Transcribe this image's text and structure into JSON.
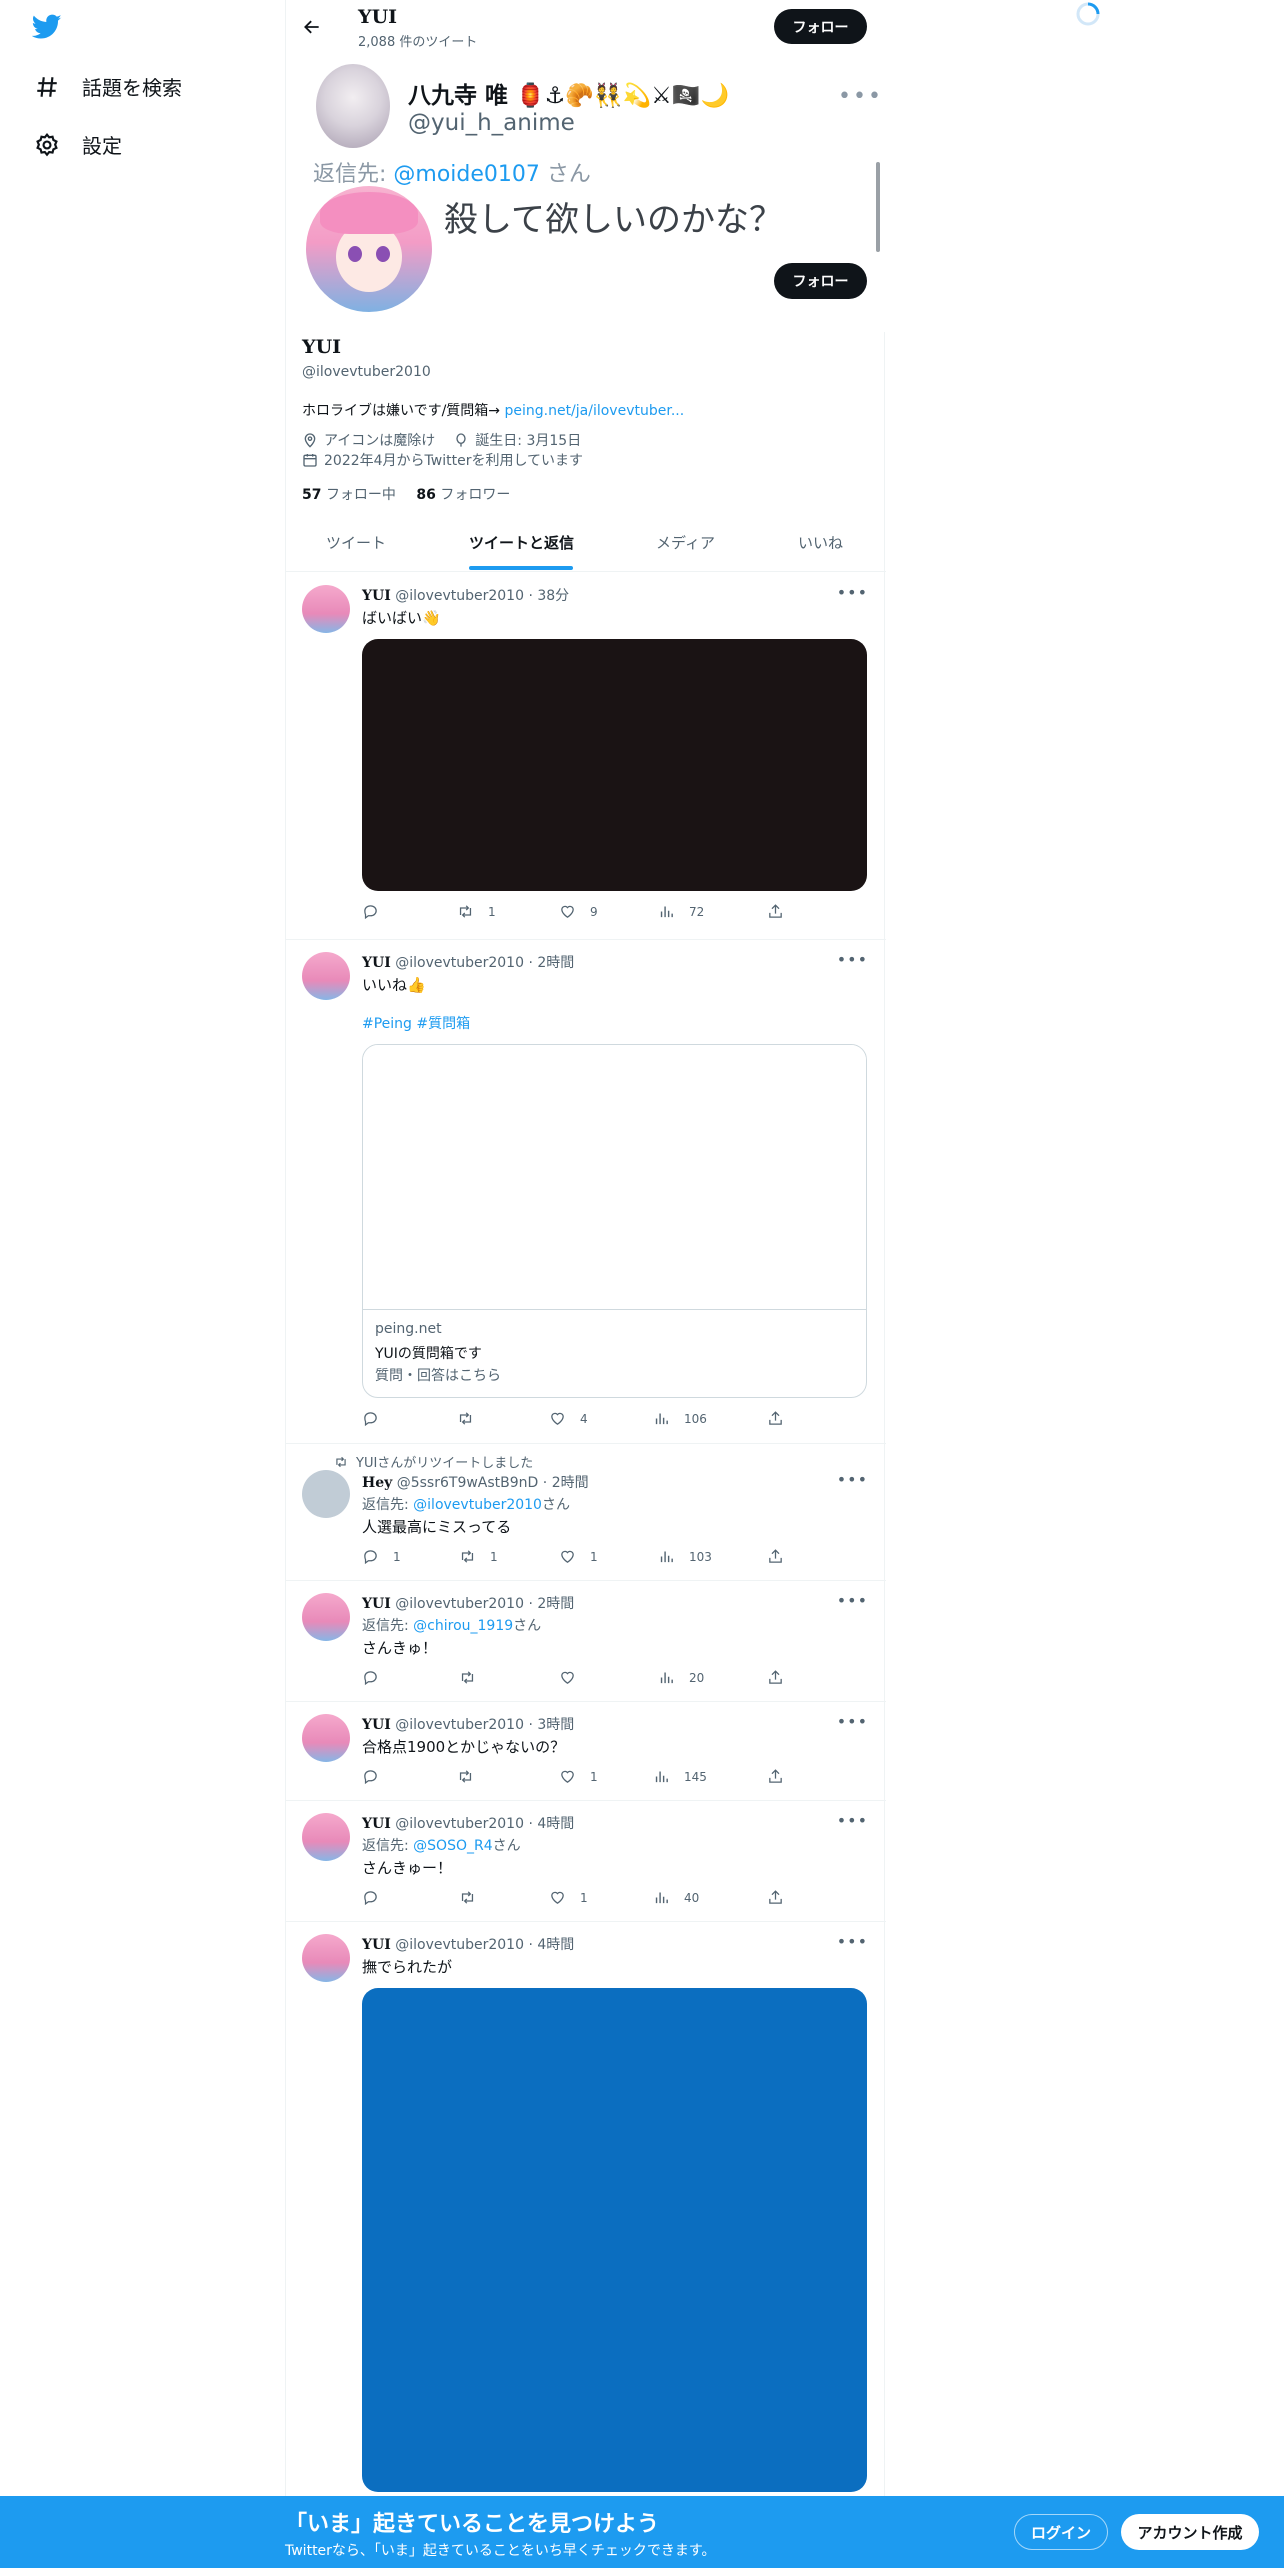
{
  "sidebar": {
    "items": [
      {
        "label": "話題を検索",
        "icon": "hashtag-icon"
      },
      {
        "label": "設定",
        "icon": "gear-icon"
      }
    ]
  },
  "header": {
    "name": "YUI",
    "tweet_count": "2,088 件のツイート",
    "follow_label": "フォロー"
  },
  "pinned_overlay": {
    "name": "八九寺 唯 🏮⚓🥐👯💫⚔🏴‍☠️🌙",
    "handle": "@yui_h_anime",
    "reply_to_prefix": "返信先: ",
    "reply_to_user": "@moide0107",
    "reply_to_suffix": " さん",
    "text": "殺して欲しいのかな？"
  },
  "profile": {
    "name": "YUI",
    "handle": "@ilovevtuber2010",
    "bio": "ホロライブは嫌いです/質問箱→ ",
    "bio_link": "peing.net/ja/ilovevtuber...",
    "location": "アイコンは魔除け",
    "birthday": "誕生日: 3月15日",
    "joined": "2022年4月からTwitterを利用しています",
    "following_count": "57",
    "following_label": "フォロー中",
    "followers_count": "86",
    "followers_label": "フォロワー",
    "follow_label": "フォロー"
  },
  "tabs": [
    {
      "label": "ツイート",
      "active": false
    },
    {
      "label": "ツイートと返信",
      "active": true
    },
    {
      "label": "メディア",
      "active": false
    },
    {
      "label": "いいね",
      "active": false
    }
  ],
  "tweets": [
    {
      "name": "YUI",
      "handle": "@ilovevtuber2010",
      "time": "38分",
      "text": "ばいばい👋",
      "media_color": "#1a1314",
      "reply": "",
      "retweet": "1",
      "like": "9",
      "views": "72"
    },
    {
      "name": "YUI",
      "handle": "@ilovevtuber2010",
      "time": "2時間",
      "text": "いいね👍",
      "hashtags": "#Peing #質問箱",
      "card_domain": "peing.net",
      "card_title": "YUIの質問箱です",
      "card_desc": "質問・回答はこちら",
      "reply": "",
      "retweet": "",
      "like": "4",
      "views": "106"
    },
    {
      "retweet_label": "YUIさんがリツイートしました",
      "name": "Hey",
      "handle": "@5ssr6T9wAstB9nD",
      "time": "2時間",
      "reply_prefix": "返信先: ",
      "reply_user": "@ilovevtuber2010",
      "reply_suffix": "さん",
      "text": "人選最高にミスってる",
      "reply": "1",
      "retweet": "1",
      "like": "1",
      "views": "103"
    },
    {
      "name": "YUI",
      "handle": "@ilovevtuber2010",
      "time": "2時間",
      "reply_prefix": "返信先: ",
      "reply_user": "@chirou_1919",
      "reply_suffix": "さん",
      "text": "さんきゅ！",
      "reply": "",
      "retweet": "",
      "like": "",
      "views": "20"
    },
    {
      "name": "YUI",
      "handle": "@ilovevtuber2010",
      "time": "3時間",
      "text": "合格点1900とかじゃないの？",
      "reply": "",
      "retweet": "",
      "like": "1",
      "views": "145"
    },
    {
      "name": "YUI",
      "handle": "@ilovevtuber2010",
      "time": "4時間",
      "reply_prefix": "返信先: ",
      "reply_user": "@SOSO_R4",
      "reply_suffix": "さん",
      "text": "さんきゅー！",
      "reply": "",
      "retweet": "",
      "like": "1",
      "views": "40"
    },
    {
      "name": "YUI",
      "handle": "@ilovevtuber2010",
      "time": "4時間",
      "text": "撫でられたが",
      "media_color": "#0b6ec0"
    }
  ],
  "banner": {
    "title": "「いま」起きていることを見つけよう",
    "subtitle": "Twitterなら、「いま」起きていることをいち早くチェックできます。",
    "login_label": "ログイン",
    "signup_label": "アカウント作成"
  },
  "colors": {
    "accent": "#1d9bf0",
    "text": "#0f1419",
    "muted": "#536471"
  }
}
